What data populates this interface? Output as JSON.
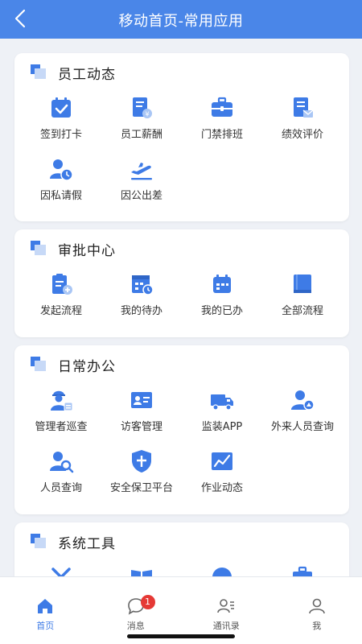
{
  "colors": {
    "accent": "#4a86e8",
    "icon": "#3e7be6",
    "badge": "#e53935"
  },
  "header": {
    "title": "移动首页-常用应用",
    "back_icon": "chevron-left-icon"
  },
  "sections": [
    {
      "title": "员工动态",
      "apps": [
        {
          "label": "签到打卡",
          "icon": "calendar-check-icon"
        },
        {
          "label": "员工薪酬",
          "icon": "salary-icon"
        },
        {
          "label": "门禁排班",
          "icon": "briefcase-icon"
        },
        {
          "label": "绩效评价",
          "icon": "document-mail-icon"
        },
        {
          "label": "因私请假",
          "icon": "person-clock-icon"
        },
        {
          "label": "因公出差",
          "icon": "plane-icon"
        }
      ]
    },
    {
      "title": "审批中心",
      "apps": [
        {
          "label": "发起流程",
          "icon": "clipboard-add-icon"
        },
        {
          "label": "我的待办",
          "icon": "calendar-clock-icon"
        },
        {
          "label": "我的已办",
          "icon": "calendar-done-icon"
        },
        {
          "label": "全部流程",
          "icon": "book-icon"
        }
      ]
    },
    {
      "title": "日常办公",
      "apps": [
        {
          "label": "管理者巡查",
          "icon": "inspector-icon"
        },
        {
          "label": "访客管理",
          "icon": "id-card-icon"
        },
        {
          "label": "监装APP",
          "icon": "truck-icon"
        },
        {
          "label": "外来人员查询",
          "icon": "person-search-icon"
        },
        {
          "label": "人员查询",
          "icon": "person-magnifier-icon"
        },
        {
          "label": "安全保卫平台",
          "icon": "shield-icon"
        },
        {
          "label": "作业动态",
          "icon": "chart-icon"
        }
      ]
    },
    {
      "title": "系统工具",
      "apps": [
        {
          "label": "",
          "icon": "tools-icon"
        },
        {
          "label": "",
          "icon": "open-book-icon"
        },
        {
          "label": "",
          "icon": "globe-icon"
        },
        {
          "label": "",
          "icon": "toolbox-icon"
        }
      ]
    }
  ],
  "tabbar": [
    {
      "label": "首页",
      "icon": "home-icon",
      "active": true
    },
    {
      "label": "消息",
      "icon": "chat-icon",
      "badge": "1"
    },
    {
      "label": "通讯录",
      "icon": "contacts-icon"
    },
    {
      "label": "我",
      "icon": "user-icon"
    }
  ]
}
